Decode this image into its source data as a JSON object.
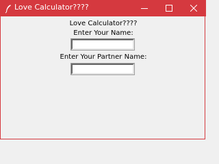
{
  "window": {
    "title": "Love Calculator????",
    "accent_color": "#d5393f"
  },
  "form": {
    "heading": "Love Calculator????",
    "name_label": "Enter Your Name:",
    "name_value": "",
    "partner_label": "Enter Your Partner Name:",
    "partner_value": ""
  },
  "icons": {
    "app": "feather-icon",
    "minimize": "minimize-icon",
    "maximize": "maximize-icon",
    "close": "close-icon"
  }
}
